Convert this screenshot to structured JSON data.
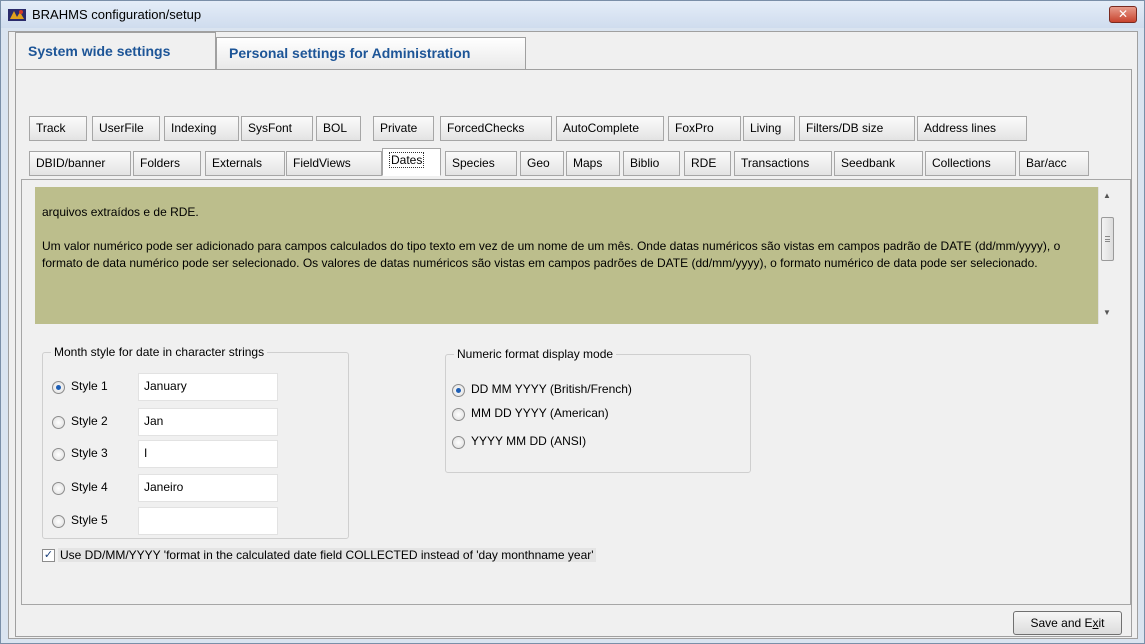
{
  "window": {
    "title": "BRAHMS configuration/setup",
    "close_glyph": "✕"
  },
  "page_tabs": [
    {
      "label": "System wide settings",
      "active": true
    },
    {
      "label": "Personal settings for Administration",
      "active": false
    }
  ],
  "sub_tabs_row1": [
    "Track",
    "UserFile",
    "Indexing",
    "SysFont",
    "BOL",
    "Private",
    "ForcedChecks",
    "AutoComplete",
    "FoxPro",
    "Living",
    "Filters/DB size",
    "Address lines"
  ],
  "sub_tabs_row2": [
    "DBID/banner",
    "Folders",
    "Externals",
    "FieldViews",
    "Dates",
    "Species",
    "Geo",
    "Maps",
    "Biblio",
    "RDE",
    "Transactions",
    "Seedbank",
    "Collections",
    "Bar/acc"
  ],
  "active_sub_tab": "Dates",
  "description": {
    "line1": "arquivos extraídos e de RDE.",
    "paragraph": "Um valor numérico pode ser adicionado para campos calculados do tipo texto em vez de um nome de um mês. Onde datas numéricos são vistas em campos padrão de DATE (dd/mm/yyyy), o formato de data numérico pode ser selecionado. Os valores de datas numéricos são vistas em campos padrões de DATE (dd/mm/yyyy), o formato numérico de data pode ser selecionado."
  },
  "month_style": {
    "legend": "Month style for date in character strings",
    "options": [
      {
        "label": "Style 1",
        "value": "January",
        "checked": true
      },
      {
        "label": "Style 2",
        "value": "Jan",
        "checked": false
      },
      {
        "label": "Style 3",
        "value": "I",
        "checked": false
      },
      {
        "label": "Style 4",
        "value": "Janeiro",
        "checked": false
      },
      {
        "label": "Style 5",
        "value": "",
        "checked": false
      }
    ]
  },
  "numeric_format": {
    "legend": "Numeric format display mode",
    "options": [
      {
        "label": "DD MM YYYY (British/French)",
        "checked": true
      },
      {
        "label": "MM DD YYYY (American)",
        "checked": false
      },
      {
        "label": "YYYY MM DD (ANSI)",
        "checked": false
      }
    ]
  },
  "use_ddmmyyyy": {
    "label": "Use DD/MM/YYYY 'format in the calculated date field COLLECTED instead of 'day monthname year'",
    "checked": true
  },
  "save_button": {
    "label_pre": "Save and E",
    "label_ul": "x",
    "label_post": "it"
  },
  "colors": {
    "description_bg": "#bcbe8c",
    "tab_text": "#1d5597",
    "radio_dot": "#1d5eb5"
  }
}
